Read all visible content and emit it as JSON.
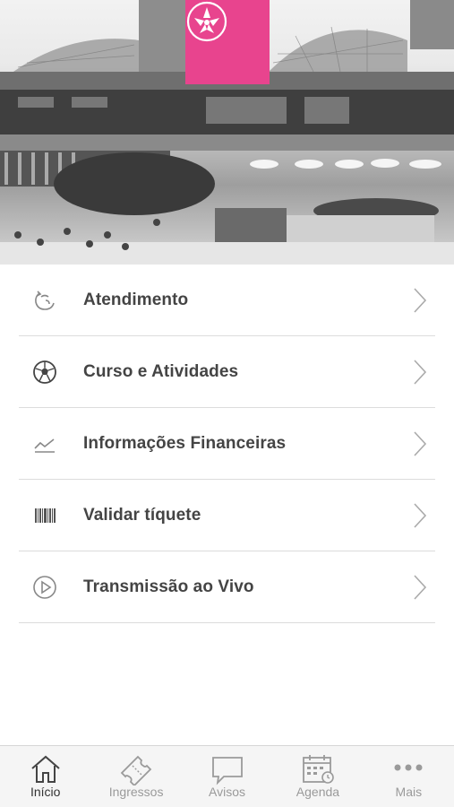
{
  "menu": {
    "items": [
      {
        "label": "Atendimento",
        "icon": "support-icon"
      },
      {
        "label": "Curso e Atividades",
        "icon": "soccer-ball-icon"
      },
      {
        "label": "Informações Financeiras",
        "icon": "line-chart-icon"
      },
      {
        "label": "Validar tíquete",
        "icon": "barcode-icon"
      },
      {
        "label": "Transmissão ao Vivo",
        "icon": "play-circle-icon"
      }
    ]
  },
  "tabs": [
    {
      "label": "Início",
      "icon": "home-icon",
      "active": true
    },
    {
      "label": "Ingressos",
      "icon": "ticket-icon",
      "active": false
    },
    {
      "label": "Avisos",
      "icon": "chat-bubble-icon",
      "active": false
    },
    {
      "label": "Agenda",
      "icon": "calendar-icon",
      "active": false
    },
    {
      "label": "Mais",
      "icon": "more-dots-icon",
      "active": false
    }
  ],
  "colors": {
    "brand": "#e8448e",
    "text": "#444444",
    "inactive_tab": "#9a9a9a",
    "divider": "#dcdcdc"
  }
}
